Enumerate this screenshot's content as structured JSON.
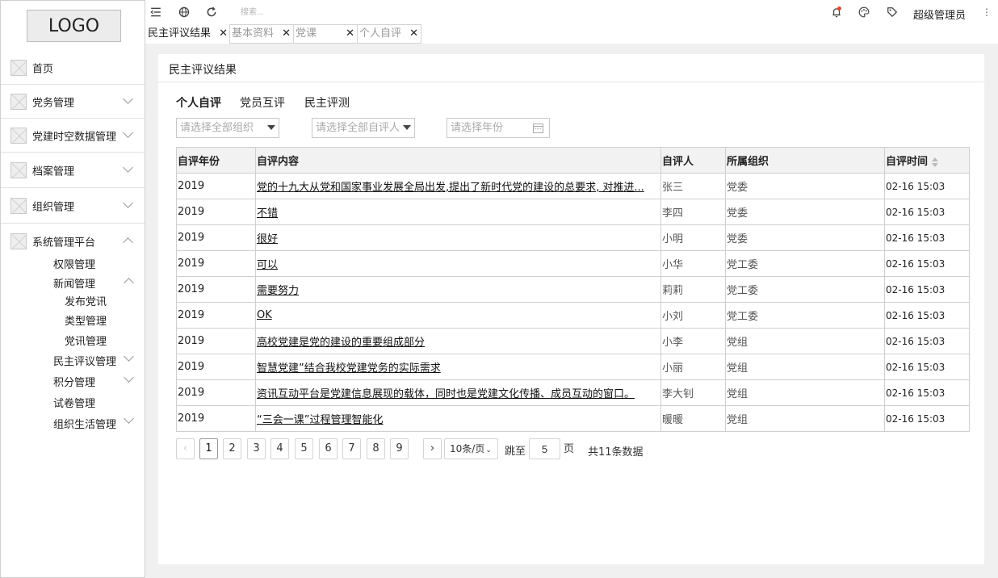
{
  "logo": "LOGO",
  "sidebar": {
    "items": [
      {
        "label": "首页"
      },
      {
        "label": "党务管理"
      },
      {
        "label": "党建时空数据管理"
      },
      {
        "label": "档案管理"
      },
      {
        "label": "组织管理"
      },
      {
        "label": "系统管理平台"
      }
    ],
    "submenu": {
      "permission": "权限管理",
      "news": "新闻管理",
      "news_children": [
        "发布党讯",
        "类型管理",
        "党讯管理"
      ],
      "democratic": "民主评议管理",
      "points": "积分管理",
      "exam": "试卷管理",
      "org_life": "组织生活管理"
    }
  },
  "topbar": {
    "search_placeholder": "搜索...",
    "user_name": "超级管理员",
    "kebab": "⋮"
  },
  "tabs": [
    {
      "label": "民主评议结果",
      "close": "✕"
    },
    {
      "label": "基本资料",
      "close": "✕"
    },
    {
      "label": "党课",
      "close": "✕"
    },
    {
      "label": "个人自评",
      "close": "✕"
    }
  ],
  "panel": {
    "title": "民主评议结果",
    "subtabs": [
      "个人自评",
      "党员互评",
      "民主评测"
    ],
    "filters": {
      "org": "请选择全部组织",
      "person": "请选择全部自评人",
      "year": "请选择年份"
    }
  },
  "table": {
    "headers": [
      "自评年份",
      "自评内容",
      "自评人",
      "所属组织",
      "自评时间"
    ],
    "rows": [
      [
        "2019",
        "党的十九大从党和国家事业发展全局出发,提出了新时代党的建设的总要求, 对推进...",
        "张三",
        "党委",
        "02-16 15:03"
      ],
      [
        "2019",
        "不错",
        "李四",
        "党委",
        "02-16 15:03"
      ],
      [
        "2019",
        "很好",
        "小明",
        "党委",
        "02-16 15:03"
      ],
      [
        "2019",
        "可以",
        "小华",
        "党工委",
        "02-16 15:03"
      ],
      [
        "2019",
        "需要努力",
        "莉莉",
        "党工委",
        "02-16 15:03"
      ],
      [
        "2019",
        "OK",
        "小刘",
        "党工委",
        "02-16 15:03"
      ],
      [
        "2019",
        "高校党建是党的建设的重要组成部分",
        "小李",
        "党组",
        "02-16 15:03"
      ],
      [
        "2019",
        "智慧党建”结合我校党建党务的实际需求",
        "小丽",
        "党组",
        "02-16 15:03"
      ],
      [
        "2019",
        "资讯互动平台是党建信息展现的载体，同时也是党建文化传播、成员互动的窗口。",
        "李大钊",
        "党组",
        "02-16 15:03"
      ],
      [
        "2019",
        "“三会一课”过程管理智能化",
        "暖暖",
        "党组",
        "02-16 15:03"
      ]
    ]
  },
  "pagination": {
    "prev": "‹",
    "next": "›",
    "pages": [
      "1",
      "2",
      "3",
      "4",
      "5",
      "6",
      "7",
      "8",
      "9"
    ],
    "page_size": "10条/页",
    "jump_label": "跳至",
    "jump_value": "5",
    "page_unit": "页",
    "total": "共11条数据"
  },
  "colors": {
    "accent_dot": "#e8462f",
    "content_bg": "#f0f0f0",
    "border": "#cfcfcf"
  }
}
